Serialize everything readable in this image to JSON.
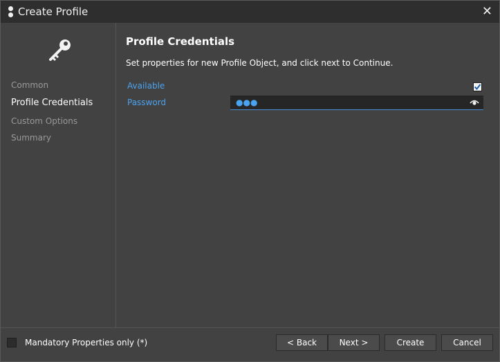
{
  "window": {
    "title": "Create Profile",
    "close_glyph": "✕"
  },
  "sidebar": {
    "icon": "key-icon",
    "items": [
      {
        "label": "Common",
        "active": false
      },
      {
        "label": "Profile Credentials",
        "active": true
      },
      {
        "label": "Custom Options",
        "active": false
      },
      {
        "label": "Summary",
        "active": false
      }
    ]
  },
  "main": {
    "title": "Profile Credentials",
    "description": "Set properties for new Profile Object, and click next to Continue.",
    "fields": {
      "available": {
        "label": "Available",
        "checked": true
      },
      "password": {
        "label": "Password",
        "masked_value": "●●●"
      }
    }
  },
  "footer": {
    "mandatory_label": "Mandatory Properties only (*)",
    "mandatory_checked": false,
    "buttons": {
      "back": "< Back",
      "next": "Next >",
      "create": "Create",
      "cancel": "Cancel"
    }
  },
  "colors": {
    "accent": "#4aa3f0",
    "background": "#424242",
    "titlebar": "#2e2e2e"
  }
}
